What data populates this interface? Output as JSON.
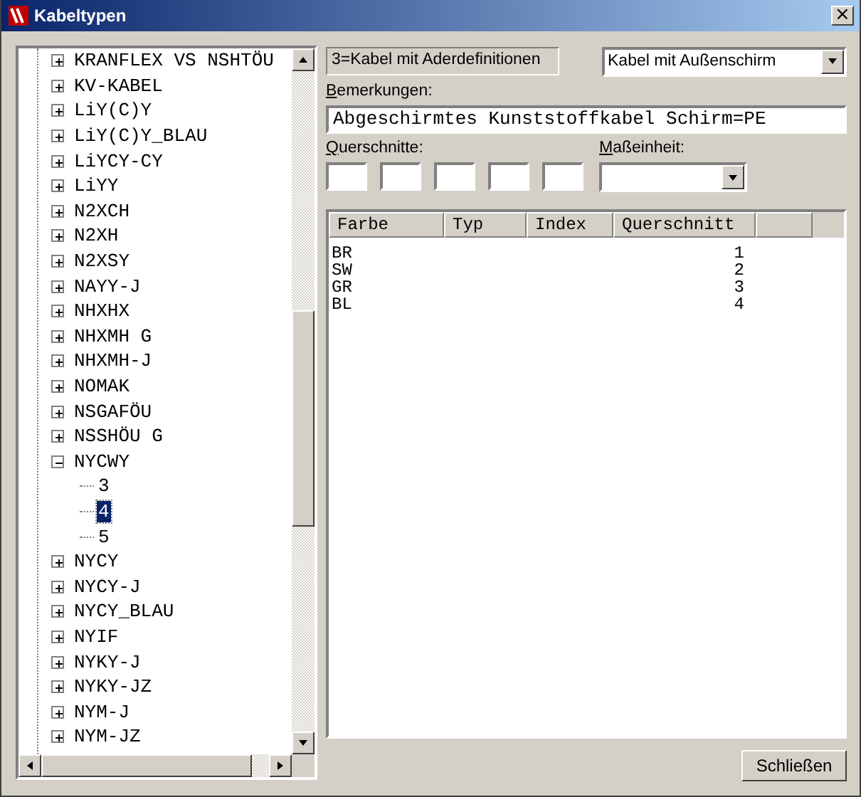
{
  "window": {
    "title": "Kabeltypen",
    "close": "×"
  },
  "tree": [
    {
      "label": "KRANFLEX VS NSHTÖU",
      "expanded": false,
      "selected": false
    },
    {
      "label": "KV-KABEL",
      "expanded": false,
      "selected": false
    },
    {
      "label": "LiY(C)Y",
      "expanded": false,
      "selected": false
    },
    {
      "label": "LiY(C)Y_BLAU",
      "expanded": false,
      "selected": false
    },
    {
      "label": "LiYCY-CY",
      "expanded": false,
      "selected": false
    },
    {
      "label": "LiYY",
      "expanded": false,
      "selected": false
    },
    {
      "label": "N2XCH",
      "expanded": false,
      "selected": false
    },
    {
      "label": "N2XH",
      "expanded": false,
      "selected": false
    },
    {
      "label": "N2XSY",
      "expanded": false,
      "selected": false
    },
    {
      "label": "NAYY-J",
      "expanded": false,
      "selected": false
    },
    {
      "label": "NHXHX",
      "expanded": false,
      "selected": false
    },
    {
      "label": "NHXMH G",
      "expanded": false,
      "selected": false
    },
    {
      "label": "NHXMH-J",
      "expanded": false,
      "selected": false
    },
    {
      "label": "NOMAK",
      "expanded": false,
      "selected": false
    },
    {
      "label": "NSGAFÖU",
      "expanded": false,
      "selected": false
    },
    {
      "label": "NSSHÖU G",
      "expanded": false,
      "selected": false
    },
    {
      "label": "NYCWY",
      "expanded": true,
      "selected": false,
      "children": [
        {
          "label": "3",
          "selected": false
        },
        {
          "label": "4",
          "selected": true
        },
        {
          "label": "5",
          "selected": false
        }
      ]
    },
    {
      "label": "NYCY",
      "expanded": false,
      "selected": false
    },
    {
      "label": "NYCY-J",
      "expanded": false,
      "selected": false
    },
    {
      "label": "NYCY_BLAU",
      "expanded": false,
      "selected": false
    },
    {
      "label": "NYIF",
      "expanded": false,
      "selected": false
    },
    {
      "label": "NYKY-J",
      "expanded": false,
      "selected": false
    },
    {
      "label": "NYKY-JZ",
      "expanded": false,
      "selected": false
    },
    {
      "label": "NYM-J",
      "expanded": false,
      "selected": false
    },
    {
      "label": "NYM-JZ",
      "expanded": false,
      "selected": false
    }
  ],
  "type_display": "3=Kabel mit Aderdefinitionen",
  "shield_dropdown": {
    "value": "Kabel mit Außenschirm"
  },
  "remarks": {
    "label": "Bemerkungen:",
    "value": "Abgeschirmtes Kunststoffkabel Schirm=PE"
  },
  "cross_sections": {
    "label": "Querschnitte:"
  },
  "unit": {
    "label": "Maßeinheit:"
  },
  "table": {
    "columns": [
      "Farbe",
      "Typ",
      "Index",
      "Querschnitt"
    ],
    "rows": [
      [
        "BR",
        "",
        "",
        "1"
      ],
      [
        "SW",
        "",
        "",
        "2"
      ],
      [
        "GR",
        "",
        "",
        "3"
      ],
      [
        "BL",
        "",
        "",
        "4"
      ]
    ]
  },
  "buttons": [
    "Schließen"
  ]
}
